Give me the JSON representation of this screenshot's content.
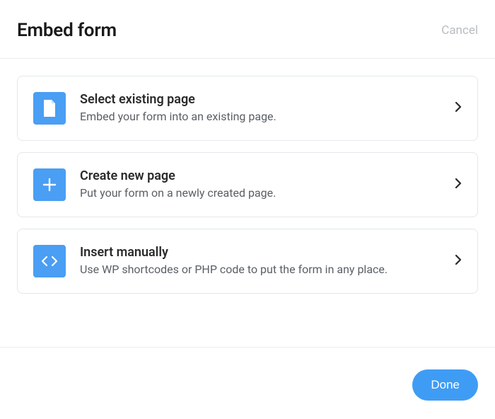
{
  "header": {
    "title": "Embed form",
    "cancel": "Cancel"
  },
  "options": [
    {
      "icon": "page-icon",
      "title": "Select existing page",
      "desc": "Embed your form into an existing page."
    },
    {
      "icon": "plus-icon",
      "title": "Create new page",
      "desc": "Put your form on a newly created page."
    },
    {
      "icon": "code-icon",
      "title": "Insert manually",
      "desc": "Use WP shortcodes or PHP code to put the form in any place."
    }
  ],
  "footer": {
    "done": "Done"
  }
}
